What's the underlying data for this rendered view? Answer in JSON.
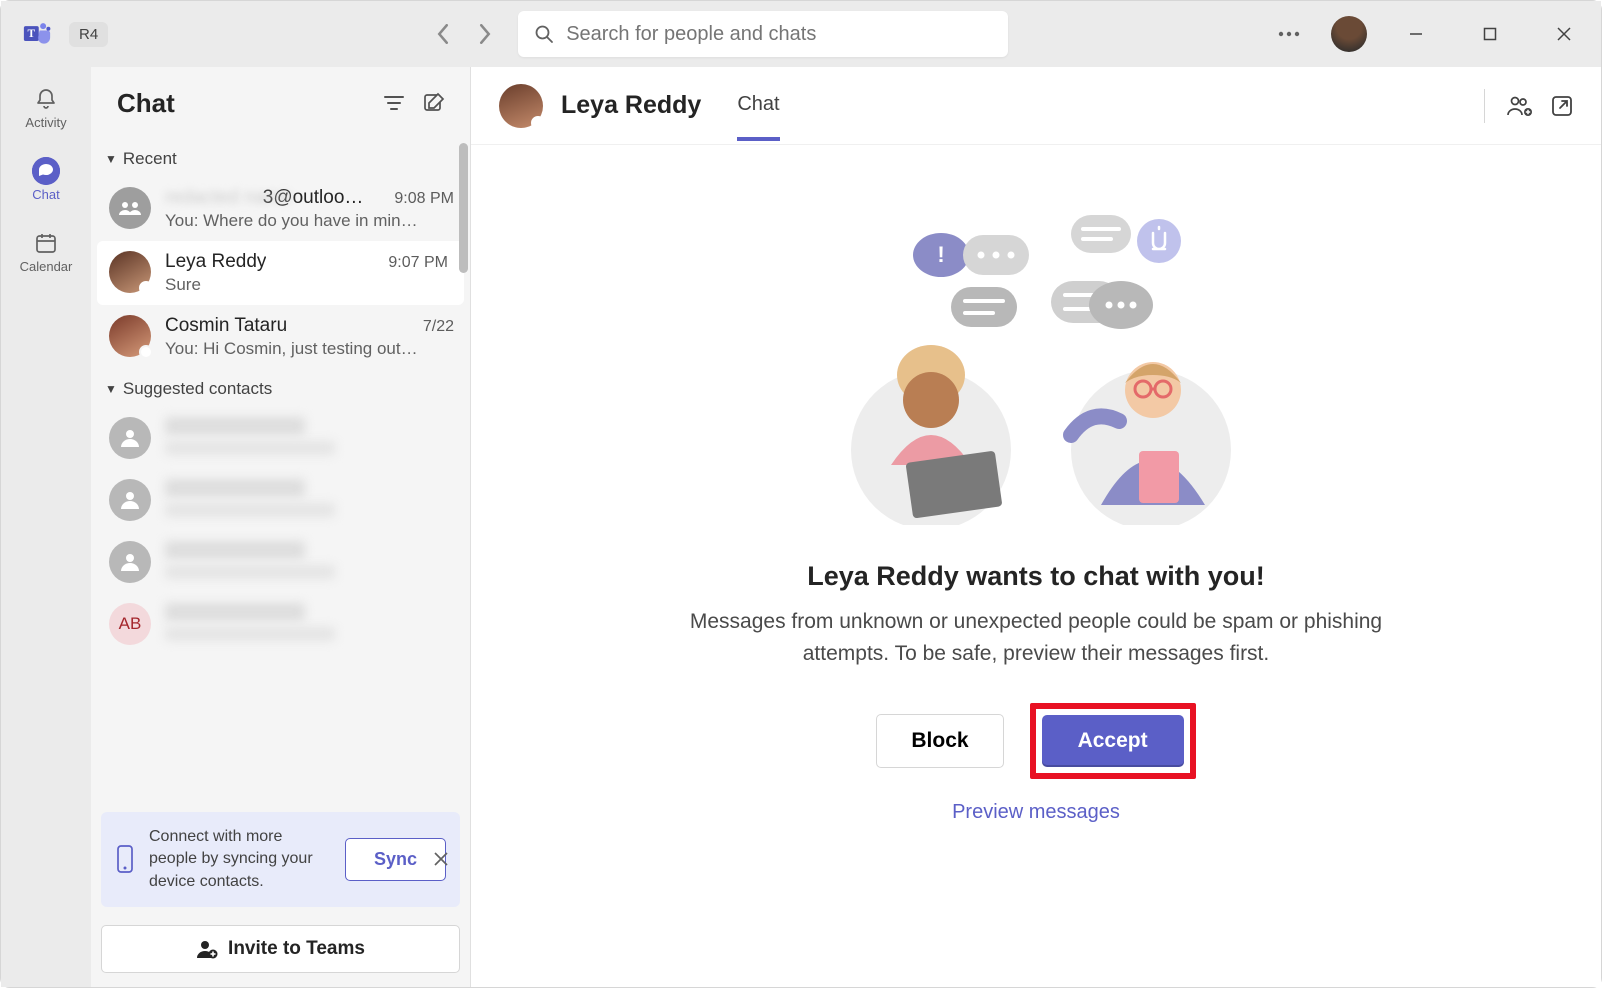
{
  "titlebar": {
    "org": "R4",
    "search_placeholder": "Search for people and chats"
  },
  "rail": {
    "items": [
      {
        "id": "activity",
        "label": "Activity"
      },
      {
        "id": "chat",
        "label": "Chat"
      },
      {
        "id": "calendar",
        "label": "Calendar"
      }
    ]
  },
  "chatlist": {
    "title": "Chat",
    "sections": {
      "recent": "Recent",
      "suggested": "Suggested contacts"
    },
    "recent": [
      {
        "name": "3@outloo…",
        "preview": "You: Where do you have in min…",
        "time": "9:08 PM",
        "group": true
      },
      {
        "name": "Leya Reddy",
        "preview": "Sure",
        "time": "9:07 PM",
        "active": true
      },
      {
        "name": "Cosmin Tataru",
        "preview": "You: Hi Cosmin, just testing out…",
        "time": "7/22"
      }
    ],
    "suggested": [
      {
        "initials": "",
        "blurred": true
      },
      {
        "initials": "",
        "blurred": true
      },
      {
        "initials": "",
        "blurred": true
      },
      {
        "initials": "AB",
        "blurred": true,
        "color": "#f3d9dc",
        "textColor": "#a4262c"
      }
    ],
    "sync": {
      "text": "Connect with more people by syncing your device contacts.",
      "button": "Sync"
    },
    "invite": "Invite to Teams"
  },
  "main": {
    "contact_name": "Leya Reddy",
    "tab": "Chat",
    "prompt_title": "Leya Reddy wants to chat with you!",
    "prompt_desc": "Messages from unknown or unexpected people could be spam or phishing attempts. To be safe, preview their messages first.",
    "block": "Block",
    "accept": "Accept",
    "preview": "Preview messages"
  }
}
